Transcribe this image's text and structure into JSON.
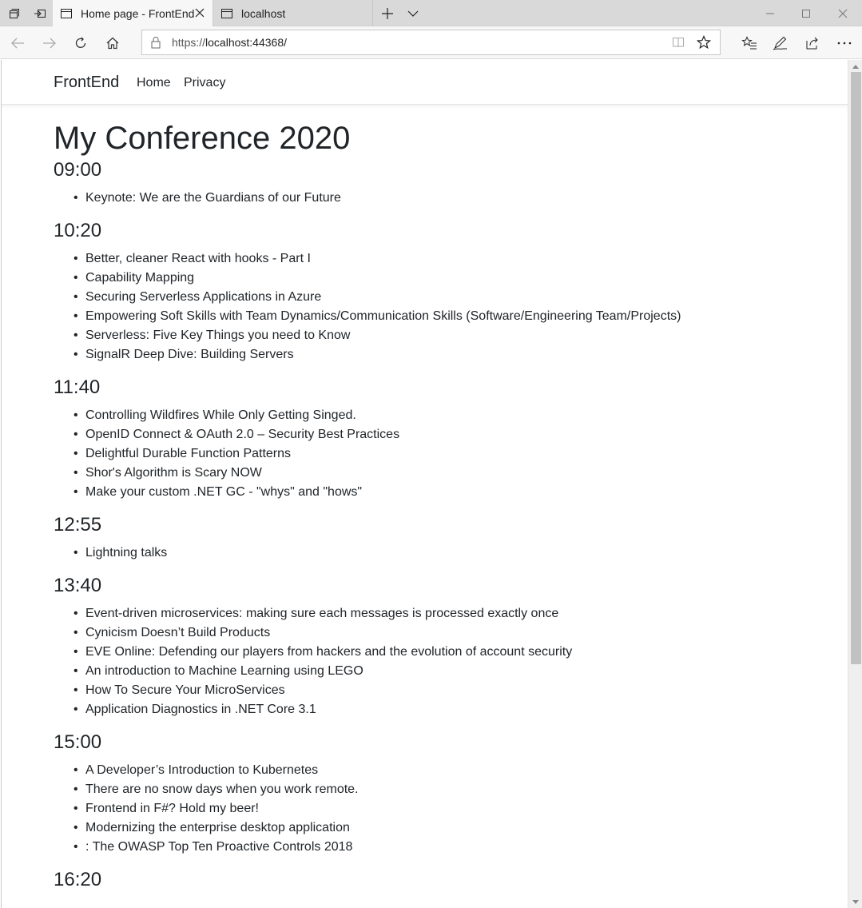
{
  "browser": {
    "tabs": [
      {
        "title": "Home page - FrontEnd",
        "active": true
      },
      {
        "title": "localhost",
        "active": false
      }
    ],
    "url_prefix": "https://",
    "url_host": "localhost:44368/",
    "icons": {
      "tab_manager": "tab-manager-icon",
      "set_aside": "set-aside-tabs-icon",
      "page": "page-icon",
      "new_tab": "plus-icon",
      "tab_list": "chevron-down-icon",
      "minimize": "minimize-icon",
      "maximize": "maximize-icon",
      "close": "close-icon",
      "back": "back-arrow-icon",
      "forward": "forward-arrow-icon",
      "refresh": "refresh-icon",
      "home": "home-icon",
      "lock": "lock-icon",
      "reading_view": "reading-view-icon",
      "favorite": "star-icon",
      "favorites_hub": "favorites-hub-icon",
      "notes": "pen-icon",
      "share": "share-icon",
      "more": "more-icon"
    }
  },
  "site": {
    "brand": "FrontEnd",
    "nav": [
      "Home",
      "Privacy"
    ]
  },
  "page": {
    "title": "My Conference 2020",
    "slots": [
      {
        "time": "09:00",
        "sessions": [
          "Keynote: We are the Guardians of our Future"
        ]
      },
      {
        "time": "10:20",
        "sessions": [
          "Better, cleaner React with hooks - Part I",
          "Capability Mapping",
          "Securing Serverless Applications in Azure",
          "Empowering Soft Skills with Team Dynamics/Communication Skills (Software/Engineering Team/Projects)",
          "Serverless: Five Key Things you need to Know",
          "SignalR Deep Dive: Building Servers"
        ]
      },
      {
        "time": "11:40",
        "sessions": [
          "Controlling Wildfires While Only Getting Singed.",
          "OpenID Connect & OAuth 2.0 – Security Best Practices",
          "Delightful Durable Function Patterns",
          "Shor's Algorithm is Scary NOW",
          "Make your custom .NET GC - \"whys\" and \"hows\""
        ]
      },
      {
        "time": "12:55",
        "sessions": [
          "Lightning talks"
        ]
      },
      {
        "time": "13:40",
        "sessions": [
          "Event-driven microservices: making sure each messages is processed exactly once",
          "Cynicism Doesn’t Build Products",
          "EVE Online: Defending our players from hackers and the evolution of account security",
          "An introduction to Machine Learning using LEGO",
          "How To Secure Your MicroServices",
          "Application Diagnostics in .NET Core 3.1"
        ]
      },
      {
        "time": "15:00",
        "sessions": [
          "A Developer’s Introduction to Kubernetes",
          "There are no snow days when you work remote.",
          "Frontend in F#? Hold my beer!",
          "Modernizing the enterprise desktop application",
          ": The OWASP Top Ten Proactive Controls 2018"
        ]
      },
      {
        "time": "16:20",
        "sessions": []
      }
    ]
  }
}
